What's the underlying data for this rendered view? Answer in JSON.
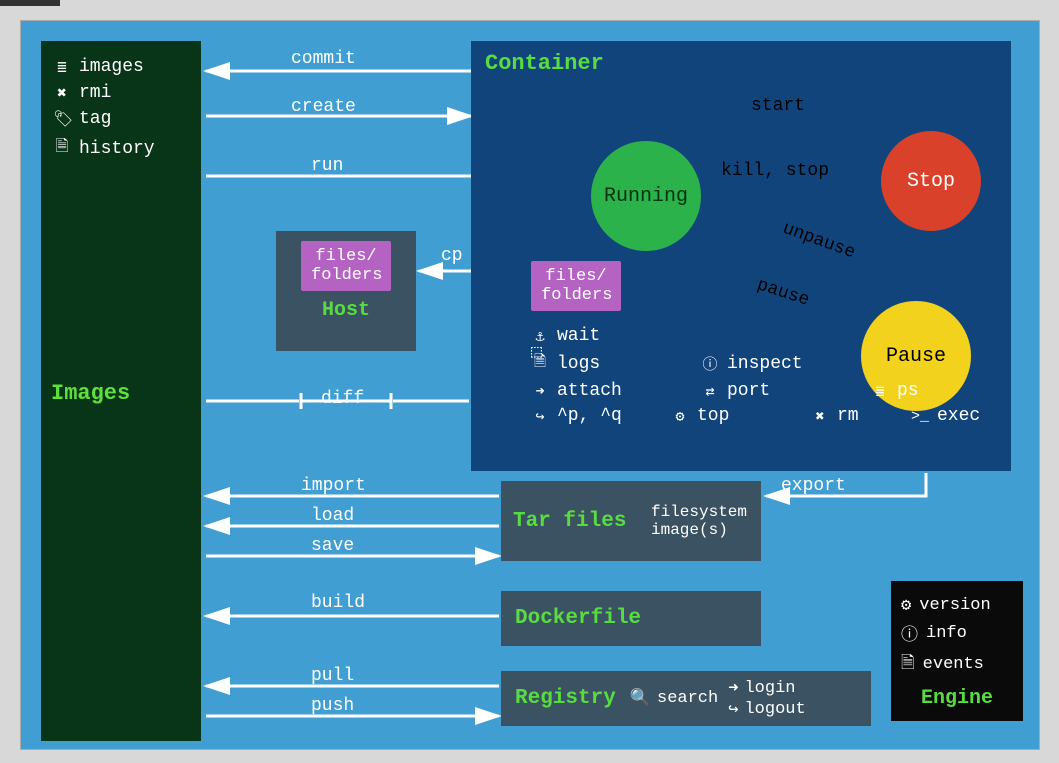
{
  "images_panel": {
    "title": "Images",
    "commands": [
      {
        "icon": "☰",
        "label": "images"
      },
      {
        "icon": "✖",
        "label": "rmi"
      },
      {
        "icon": "🏷",
        "label": "tag"
      },
      {
        "icon": "🗎",
        "label": "history"
      }
    ]
  },
  "container_panel": {
    "title": "Container",
    "states": {
      "running": "Running",
      "stop": "Stop",
      "pause": "Pause"
    },
    "files_label": "files/\nfolders",
    "transitions": {
      "start": "start",
      "kill_stop": "kill, stop",
      "pause": "pause",
      "unpause": "unpause"
    },
    "commands": [
      [
        {
          "icon": "⚓",
          "label": "wait"
        }
      ],
      [
        {
          "icon": "🗎",
          "label": "logs"
        },
        {
          "icon": "ⓘ",
          "label": "inspect"
        }
      ],
      [
        {
          "icon": "➜",
          "label": "attach"
        },
        {
          "icon": "⇄",
          "label": "port"
        },
        {
          "icon": "☰",
          "label": "ps"
        }
      ],
      [
        {
          "icon": "↪",
          "label": "^p, ^q"
        },
        {
          "icon": "⚙",
          "label": "top"
        },
        {
          "icon": "✖",
          "label": "rm"
        },
        {
          "icon": ">_",
          "label": "exec"
        }
      ]
    ]
  },
  "host_panel": {
    "title": "Host",
    "files_label": "files/\nfolders"
  },
  "tar_panel": {
    "title": "Tar files",
    "rows": [
      "filesystem",
      "image(s)"
    ]
  },
  "dockerfile_panel": {
    "title": "Dockerfile"
  },
  "registry_panel": {
    "title": "Registry",
    "commands": [
      {
        "icon": "🔍",
        "label": "search"
      },
      {
        "icon": "➜",
        "label": "login"
      },
      {
        "icon": "↪",
        "label": "logout"
      }
    ]
  },
  "engine_panel": {
    "title": "Engine",
    "commands": [
      {
        "icon": "⚙",
        "label": "version"
      },
      {
        "icon": "ⓘ",
        "label": "info"
      },
      {
        "icon": "🗎",
        "label": "events"
      }
    ]
  },
  "arrows": {
    "commit": "commit",
    "create": "create",
    "run": "run",
    "cp": "cp",
    "diff": "diff",
    "import": "import",
    "load": "load",
    "save": "save",
    "build": "build",
    "pull": "pull",
    "push": "push",
    "export": "export"
  }
}
